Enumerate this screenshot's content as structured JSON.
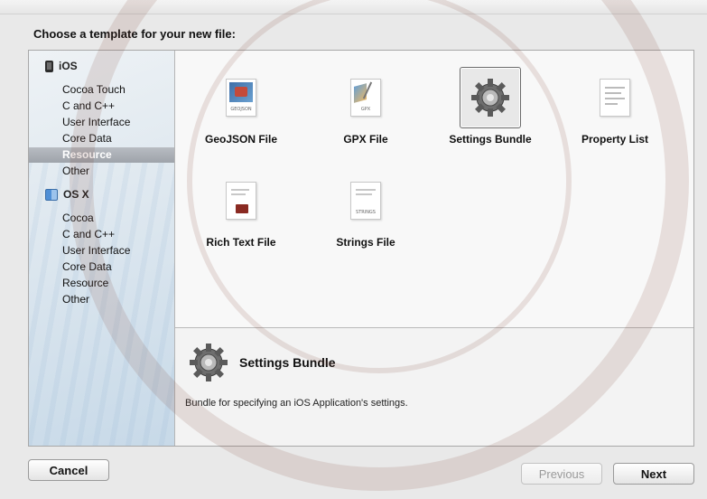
{
  "dialog": {
    "title": "Choose a template for your new file:"
  },
  "sidebar": {
    "groups": [
      {
        "label": "iOS",
        "icon": "ios-device-icon",
        "items": [
          "Cocoa Touch",
          "C and C++",
          "User Interface",
          "Core Data",
          "Resource",
          "Other"
        ],
        "selected": "Resource"
      },
      {
        "label": "OS X",
        "icon": "finder-icon",
        "items": [
          "Cocoa",
          "C and C++",
          "User Interface",
          "Core Data",
          "Resource",
          "Other"
        ]
      }
    ]
  },
  "templates": [
    {
      "label": "GeoJSON File",
      "icon": "geojson-file-icon",
      "tag": "GEOJSON"
    },
    {
      "label": "GPX File",
      "icon": "gpx-file-icon",
      "tag": "GPX"
    },
    {
      "label": "Settings Bundle",
      "icon": "gear-icon",
      "selected": true
    },
    {
      "label": "Property List",
      "icon": "property-list-icon"
    },
    {
      "label": "Rich Text File",
      "icon": "rich-text-file-icon"
    },
    {
      "label": "Strings File",
      "icon": "strings-file-icon",
      "tag": "STRINGS"
    }
  ],
  "detail": {
    "title": "Settings Bundle",
    "description": "Bundle for specifying an iOS Application's settings.",
    "icon": "gear-icon"
  },
  "buttons": {
    "cancel": "Cancel",
    "previous": "Previous",
    "next": "Next"
  },
  "colors": {
    "selection": "#a8adb3",
    "sidebar_tint": "#c7d9e8"
  }
}
